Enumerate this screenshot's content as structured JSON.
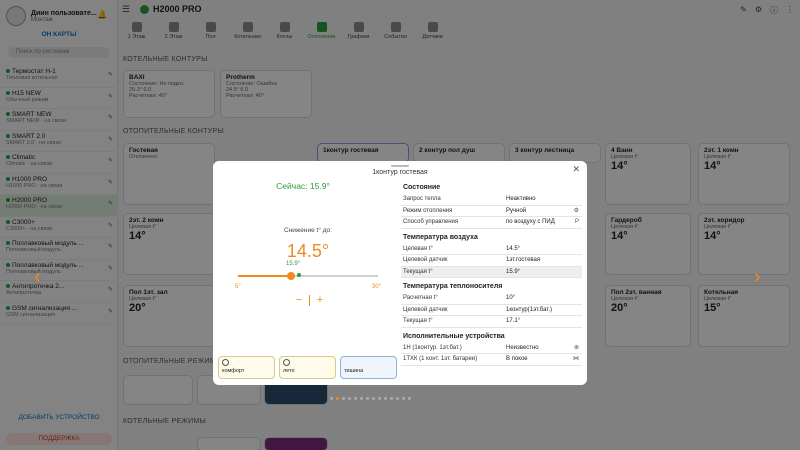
{
  "sidebar": {
    "user_name": "Диин пользовате...",
    "user_role": "Монтаж",
    "map_button": "ОН КАРТЫ",
    "search_placeholder": "Поиск по системам",
    "devices": [
      {
        "title": "Термостат Н-1",
        "sub": "Тепловая котельная"
      },
      {
        "title": "H15 NEW",
        "sub": "Обычный режим"
      },
      {
        "title": "SMART NEW",
        "sub": "SMART NEW · на связи"
      },
      {
        "title": "SMART 2.0",
        "sub": "SMART 2.0 · на связи"
      },
      {
        "title": "Climatic",
        "sub": "Climatic · на связи"
      },
      {
        "title": "H1000 PRO",
        "sub": "H1000 PRO · на связи"
      },
      {
        "title": "H2000 PRO",
        "sub": "H2000 PRO · на связи"
      },
      {
        "title": "C3000+",
        "sub": "C3000+ · на связи"
      },
      {
        "title": "Поплавковый модуль ...",
        "sub": "Поплавковый модуль"
      },
      {
        "title": "Поплавковый модуль ...",
        "sub": "Поплавковый модуль"
      },
      {
        "title": "Антипротечка 2...",
        "sub": "Антипротечка"
      },
      {
        "title": "GSM сигнализация ...",
        "sub": "GSM сигнализация"
      }
    ],
    "add_button": "ДОБАВИТЬ УСТРОЙСТВО",
    "support_button": "ПОДДЕРЖКА"
  },
  "header": {
    "title": "H2000 PRO",
    "tabs": [
      "1 Этаж",
      "2 Этаж",
      "Пол",
      "Котельная",
      "Котлы",
      "Отопление",
      "Графики",
      "События",
      "Датчики"
    ]
  },
  "background": {
    "section_boilers": "КОТЕЛЬНЫЕ КОНТУРЫ",
    "section_heating": "ОТОПИТЕЛЬНЫЕ КОНТУРЫ",
    "section_modes": "ОТОПИТЕЛЬНЫЕ РЕЖИМЫ",
    "section_other": "КОТЕЛЬНЫЕ РЕЖИМЫ",
    "boiler_cards": [
      {
        "name": "BAXI",
        "line1": "Состояние: Не подкл.",
        "line2": "25.3° 6.0",
        "line3": "Расчетная: 40°"
      },
      {
        "name": "Protherm",
        "line1": "Состояние: Ошибка",
        "line2": "24.5° 6.0",
        "line3": "Расчетная: 40°"
      }
    ],
    "heat_cards_top": [
      {
        "name": "Гостевая",
        "line1": "Отключено",
        "big": ""
      },
      {
        "name": "1контур гостевая",
        "line1": "",
        "big": ""
      },
      {
        "name": "2 контур пол душ",
        "line1": "",
        "big": ""
      },
      {
        "name": "3 контур лестница",
        "line1": "",
        "big": ""
      },
      {
        "name": "4 Ванн",
        "line1": "Целевая t°",
        "big": "14°"
      },
      {
        "name": "2эт. 1 комн",
        "line1": "Целевая t°",
        "big": "14°"
      }
    ],
    "heat_cards_mid": [
      {
        "name": "2эт. 2 комн",
        "line1": "Целевая t°",
        "big": "14°"
      },
      {
        "name": "Гардероб",
        "line1": "Целевая t°",
        "big": "14°"
      },
      {
        "name": "2эт. коридор",
        "line1": "Целевая t°",
        "big": "14°"
      }
    ],
    "heat_cards_bot": [
      {
        "name": "Пол 1эт. зал",
        "line1": "Целевая t°",
        "big": "20°"
      },
      {
        "name": "Пол 2эт. ванная",
        "line1": "Целевая t°",
        "big": "20°"
      },
      {
        "name": "Котельная",
        "line1": "Целевая t°",
        "big": "15°"
      }
    ]
  },
  "modal": {
    "title": "1контур гостевая",
    "current": "Сейчас: 15.9°",
    "reduction_label": "Снижение t° до:",
    "setpoint": "14.5°",
    "current_mark": "15.9°",
    "slider": {
      "min": 5,
      "max": 30,
      "value": 14.5,
      "current": 15.9
    },
    "min_label": "5°",
    "max_label": "30°",
    "minus": "−",
    "plus": "+",
    "modes": [
      "комфорт",
      "лето",
      "тишина"
    ],
    "info": {
      "state_header": "Состояние",
      "state_rows": [
        {
          "k": "Запрос тепла",
          "v": "Неактивно"
        },
        {
          "k": "Режим отопления",
          "v": "Ручной"
        },
        {
          "k": "Способ управления",
          "v": "по воздуху с ПИД"
        }
      ],
      "air_header": "Температура воздуха",
      "air_rows": [
        {
          "k": "Целевая t°",
          "v": "14.5°"
        },
        {
          "k": "Целевой датчик",
          "v": "1эт.гостевая"
        },
        {
          "k": "Текущая t°",
          "v": "15.9°"
        }
      ],
      "carrier_header": "Температура теплоносителя",
      "carrier_rows": [
        {
          "k": "Расчетная t°",
          "v": "10°"
        },
        {
          "k": "Целевой датчик",
          "v": "1контур(1эт.бат.)"
        },
        {
          "k": "Текущая t°",
          "v": "17.1°"
        }
      ],
      "exec_header": "Исполнительные устройства",
      "exec_rows": [
        {
          "k": "1Н (1контур. 1эт.бат.)",
          "v": "Неизвестно"
        },
        {
          "k": "1ТХК (1 конт. 1эт. батареи)",
          "v": "В покое"
        }
      ]
    }
  },
  "colors": {
    "accent": "#f08a1c",
    "ok": "#2e9b3c",
    "link": "#0b6fb8"
  }
}
